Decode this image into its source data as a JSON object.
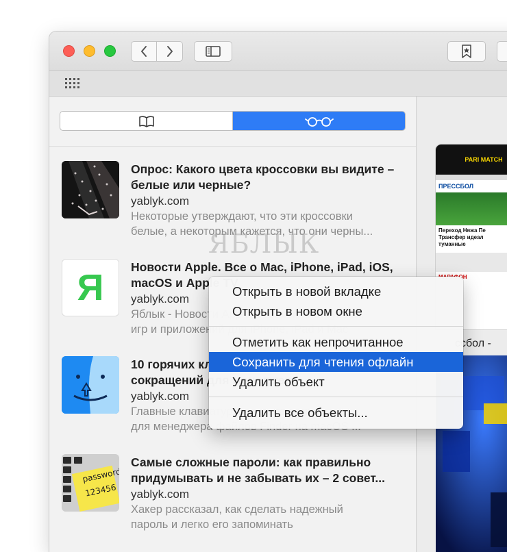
{
  "toolbar": {
    "back_icon": "chevron-left-icon",
    "forward_icon": "chevron-right-icon",
    "sidebar_icon": "sidebar-icon",
    "bookmark_icon": "star-bookmark-icon"
  },
  "sidebar": {
    "tabs": [
      {
        "name": "bookmarks",
        "icon": "book-icon",
        "active": false
      },
      {
        "name": "reading-list",
        "icon": "glasses-icon",
        "active": true
      }
    ],
    "accent_color": "#2e7cf6",
    "items": [
      {
        "title": "Опрос: Какого цвета кроссовки вы видите – белые или черные?",
        "domain": "yablyk.com",
        "desc_line1": "Некоторые утверждают, что эти кроссовки",
        "desc_line2": "белые, а некоторым кажется, что они черны..."
      },
      {
        "title": "Новости Apple. Все о Mac, iPhone, iPad, iOS, macOS и Apple TV",
        "domain": "yablyk.com",
        "desc_line1": "Яблык - Новости Apple, обзоры, инструкции,",
        "desc_line2": "игр и приложений для iPhone, iPad и Mac"
      },
      {
        "title": "10 горячих клавиш и клавиатурных сокращений для менеджера",
        "domain": "yablyk.com",
        "desc_line1": "Главные клавиатурные сокращения",
        "desc_line2": "для менеджера файлов Finder на macOS ..."
      },
      {
        "title": "Самые сложные пароли: как правильно придумывать и не забывать их – 2 совет...",
        "domain": "yablyk.com",
        "desc_line1": "Хакер рассказал, как сделать надежный",
        "desc_line2": "пароль и легко его запоминать"
      }
    ],
    "logo_letter": "Я",
    "sticky_text_1": "password",
    "sticky_text_2": "123456"
  },
  "watermark": "ЯБЛЫК",
  "context_menu": {
    "items": [
      {
        "label": "Открыть в новой вкладке",
        "highlighted": false
      },
      {
        "label": "Открыть в новом окне",
        "highlighted": false
      },
      {
        "label": "Отметить как непрочитанное",
        "highlighted": false
      },
      {
        "label": "Сохранить для чтения офлайн",
        "highlighted": true
      },
      {
        "label": "Удалить объект",
        "highlighted": false
      },
      {
        "label": "Удалить все объекты...",
        "highlighted": false
      }
    ],
    "highlight_color": "#1a65d9"
  },
  "preview": {
    "card_brand": "PARI MATCH",
    "card_section": "ПРЕССБОЛ",
    "card_headline_1": "Переход Няжа Пе",
    "card_headline_2": "Трансфер идеал",
    "card_headline_3": "туманные",
    "card_footer": "МАРАФОН",
    "caption": "ссбол -"
  }
}
